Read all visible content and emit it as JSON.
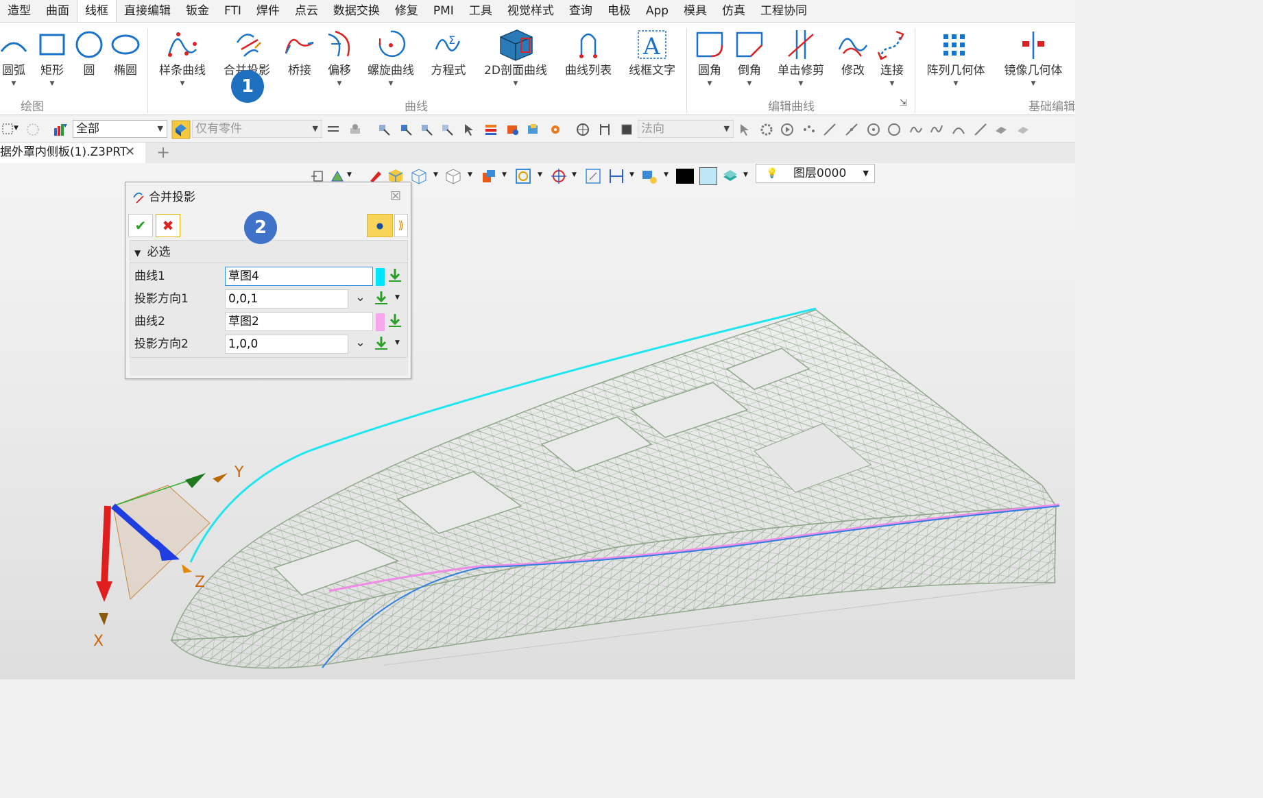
{
  "menubar": {
    "items": [
      "造型",
      "曲面",
      "线框",
      "直接编辑",
      "钣金",
      "FTI",
      "焊件",
      "点云",
      "数据交换",
      "修复",
      "PMI",
      "工具",
      "视觉样式",
      "查询",
      "电极",
      "App",
      "模具",
      "仿真",
      "工程协同"
    ],
    "active_index": 2
  },
  "ribbon": {
    "draw": {
      "label": "绘图",
      "buttons": [
        "圆弧",
        "矩形",
        "圆",
        "椭圆"
      ]
    },
    "curve": {
      "label": "曲线",
      "buttons": [
        "样条曲线",
        "合并投影",
        "桥接",
        "偏移",
        "螺旋曲线",
        "方程式",
        "2D剖面曲线",
        "曲线列表",
        "线框文字"
      ]
    },
    "edit": {
      "label": "编辑曲线",
      "buttons": [
        "圆角",
        "倒角",
        "单击修剪",
        "修改",
        "连接"
      ]
    },
    "basic": {
      "label": "基础编辑",
      "buttons": [
        "阵列几何体",
        "镜像几何体"
      ]
    }
  },
  "badges": {
    "one": "1",
    "two": "2"
  },
  "toolbar": {
    "filter_value": "全部",
    "parts_only": "仅有零件",
    "direction": "法向"
  },
  "document": {
    "tab_label": "据外罩内侧板(1).Z3PRT",
    "close": "✕",
    "add": "+"
  },
  "view": {
    "layer": "图层0000"
  },
  "dialog": {
    "title": "合并投影",
    "close": "☒",
    "section": "必选",
    "fields": [
      {
        "label": "曲线1",
        "value": "草图4",
        "color": "#00e5ff"
      },
      {
        "label": "投影方向1",
        "value": "0,0,1"
      },
      {
        "label": "曲线2",
        "value": "草图2",
        "color": "#f7a6ee"
      },
      {
        "label": "投影方向2",
        "value": "1,0,0"
      }
    ]
  },
  "triad": {
    "x": "X",
    "y": "Y",
    "z": "Z"
  },
  "colors": {
    "accent": "#1f6fbf",
    "curve1": "#1ee6f0",
    "curve2": "#f08ce8",
    "projected": "#2f7fe0",
    "mesh": "#8fa88a"
  }
}
